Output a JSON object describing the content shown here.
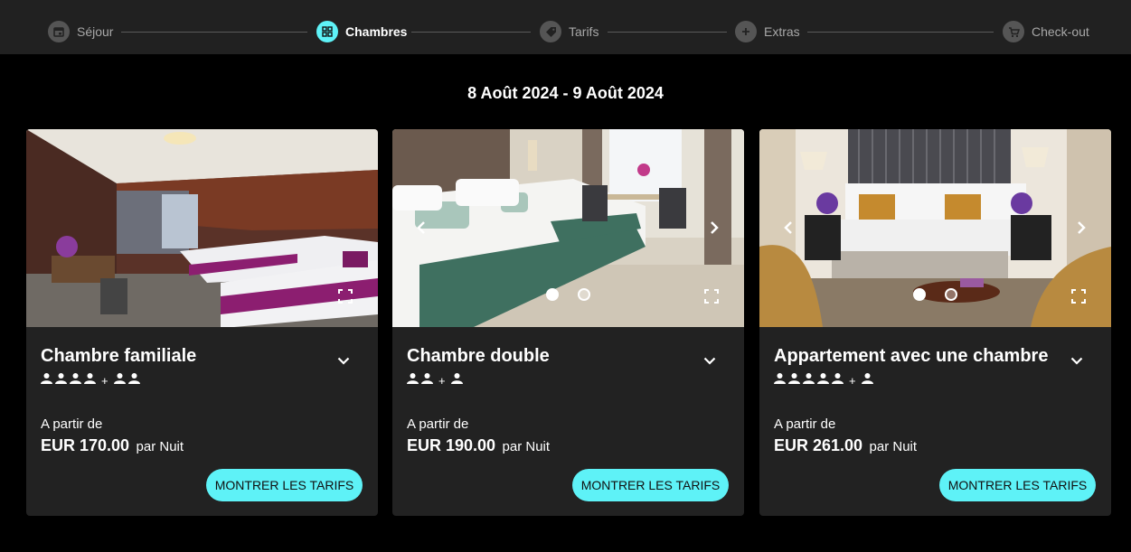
{
  "stepper": {
    "steps": [
      {
        "label": "Séjour",
        "icon": "calendar-icon",
        "active": false
      },
      {
        "label": "Chambres",
        "icon": "grid-icon",
        "active": true
      },
      {
        "label": "Tarifs",
        "icon": "tag-icon",
        "active": false
      },
      {
        "label": "Extras",
        "icon": "plus-icon",
        "active": false
      },
      {
        "label": "Check-out",
        "icon": "cart-icon",
        "active": false
      }
    ]
  },
  "date_range": "8 Août 2024 - 9 Août 2024",
  "colors": {
    "accent": "#5ef2f7",
    "background": "#000000",
    "card": "#222222",
    "stepper_bg": "#212121"
  },
  "rooms": [
    {
      "name": "Chambre familiale",
      "adults": 4,
      "children": 2,
      "from_label": "A partir de",
      "price": "EUR 170.00",
      "price_unit": "par Nuit",
      "button_label": "MONTRER LES TARIFS",
      "has_carousel_arrows": false,
      "carousel_dots": 0
    },
    {
      "name": "Chambre double",
      "adults": 2,
      "children": 1,
      "from_label": "A partir de",
      "price": "EUR 190.00",
      "price_unit": "par Nuit",
      "button_label": "MONTRER LES TARIFS",
      "has_carousel_arrows": true,
      "carousel_dots": 2
    },
    {
      "name": "Appartement avec une chambre",
      "adults": 5,
      "children": 1,
      "from_label": "A partir de",
      "price": "EUR 261.00",
      "price_unit": "par Nuit",
      "button_label": "MONTRER LES TARIFS",
      "has_carousel_arrows": true,
      "carousel_dots": 2
    }
  ]
}
